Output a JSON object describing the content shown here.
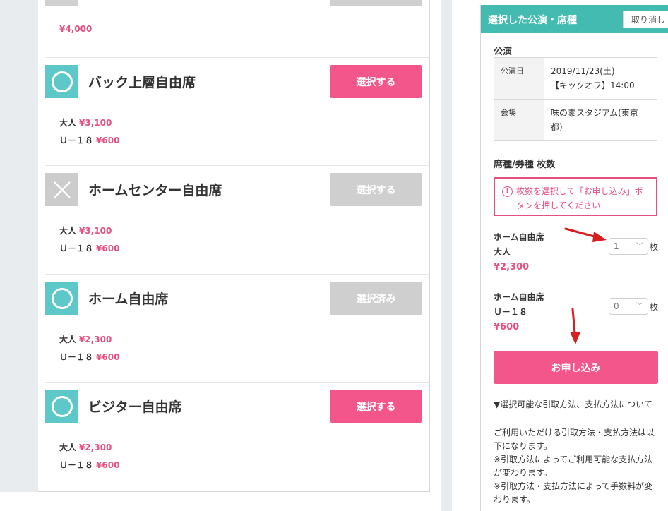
{
  "previous_seat": {
    "price": "¥4,000"
  },
  "seats": [
    {
      "name": "バック上層自由席",
      "available": true,
      "button": "選択する",
      "prices": [
        {
          "label": "大人",
          "value": "¥3,100"
        },
        {
          "label": "Ｕ－１８",
          "value": "¥600"
        }
      ]
    },
    {
      "name": "ホームセンター自由席",
      "available": false,
      "button": "選択する",
      "prices": [
        {
          "label": "大人",
          "value": "¥3,100"
        },
        {
          "label": "Ｕ－１８",
          "value": "¥600"
        }
      ]
    },
    {
      "name": "ホーム自由席",
      "available": true,
      "button": "選択済み",
      "prices": [
        {
          "label": "大人",
          "value": "¥2,300"
        },
        {
          "label": "Ｕ－１８",
          "value": "¥600"
        }
      ]
    },
    {
      "name": "ビジター自由席",
      "available": true,
      "button": "選択する",
      "prices": [
        {
          "label": "大人",
          "value": "¥2,300"
        },
        {
          "label": "Ｕ－１８",
          "value": "¥600"
        }
      ]
    }
  ],
  "sidebar": {
    "title": "選択した公演・席種",
    "cancel": "取り消し",
    "performance_heading": "公演",
    "date_label": "公演日",
    "date_value_1": "2019/11/23(土)",
    "date_value_2": "【キックオフ】14:00",
    "venue_label": "会場",
    "venue_value_1": "味の素スタジアム(東京",
    "venue_value_2": "都)",
    "seat_heading": "席種/券種 枚数",
    "notice_1": "枚数を選択して「お申し込み」ボ",
    "notice_2": "タンを押してください",
    "tickets": [
      {
        "seat": "ホーム自由席",
        "type": "大人",
        "price": "¥2,300",
        "qty": "1",
        "unit": "枚"
      },
      {
        "seat": "ホーム自由席",
        "type": "Ｕ－１８",
        "price": "¥600",
        "qty": "0",
        "unit": "枚"
      }
    ],
    "apply": "お申し込み",
    "methods_heading": "▼選択可能な引取方法、支払方法について",
    "methods_lines": [
      "ご利用いただける引取方法・支払方法は以",
      "下になります。",
      "※引取方法によってご利用可能な支払方法",
      "が変わります。",
      "※引取方法・支払方法によって手数料が変",
      "わります。"
    ]
  },
  "colors": {
    "accent_pink": "#f2568a",
    "price_pink": "#e6507f",
    "teal": "#44bbb0",
    "available_icon": "#5ec8c8",
    "disabled": "#cfcfcf",
    "arrow_red": "#d42020"
  },
  "icons": {
    "available": "circle-icon",
    "sold_out": "cross-icon",
    "alert": "alert-circle-icon",
    "select": "chevron-down-icon",
    "annotation": "red-arrow"
  }
}
